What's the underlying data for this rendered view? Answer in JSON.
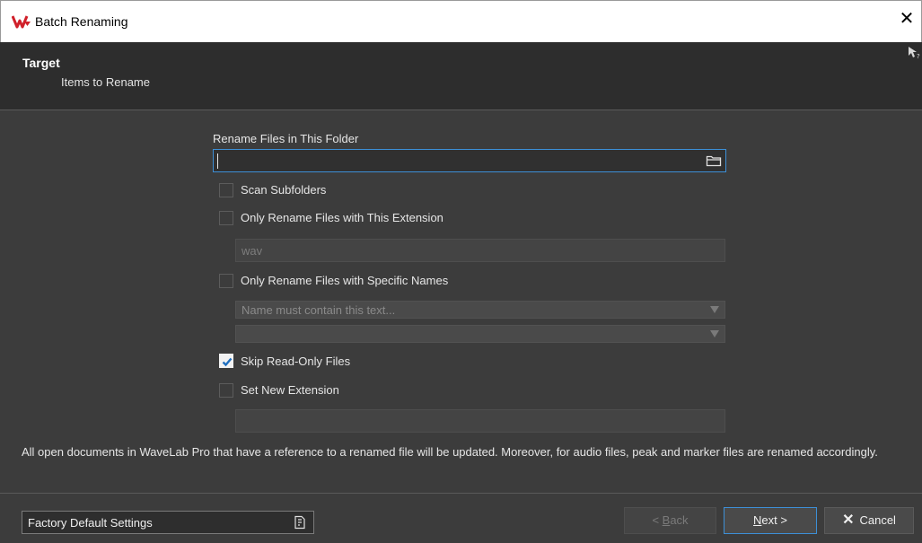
{
  "window": {
    "title": "Batch Renaming",
    "close_glyph": "✕"
  },
  "header": {
    "title": "Target",
    "subtitle": "Items to Rename"
  },
  "form": {
    "folder_label": "Rename Files in This Folder",
    "folder_value": "",
    "scan_subfolders": {
      "label": "Scan Subfolders",
      "checked": false
    },
    "only_extension": {
      "label": "Only Rename Files with This Extension",
      "checked": false
    },
    "extension_value": "wav",
    "only_specific_names": {
      "label": "Only Rename Files with Specific Names",
      "checked": false
    },
    "names_combo_1": "Name must contain this text...",
    "names_combo_2": "",
    "skip_readonly": {
      "label": "Skip Read-Only Files",
      "checked": true
    },
    "set_new_extension": {
      "label": "Set New Extension",
      "checked": false
    },
    "new_extension_value": ""
  },
  "note": "All open documents in WaveLab Pro that have a reference to a renamed file will be updated. Moreover, for audio files, peak and marker files are renamed accordingly.",
  "footer": {
    "preset_label": "Factory Default Settings",
    "back_prefix": "< ",
    "back_key": "B",
    "back_rest": "ack",
    "next_key": "N",
    "next_rest": "ext >",
    "cancel_label": "Cancel"
  },
  "colors": {
    "accent": "#3d8fd6",
    "logo_red": "#d0202a"
  }
}
